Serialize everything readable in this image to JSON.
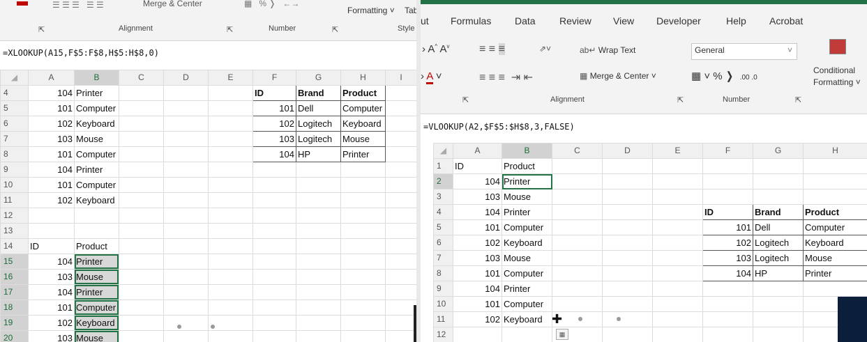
{
  "left": {
    "ribbon": {
      "groups": [
        "Alignment",
        "Number"
      ],
      "partial_labels": [
        "Formatting",
        "Tab",
        "Style"
      ],
      "merge_partial": "Merge & Center"
    },
    "formula": "=XLOOKUP(A15,F$5:F$8,H$5:H$8,0)",
    "columns": [
      "A",
      "B",
      "C",
      "D",
      "E",
      "F",
      "G",
      "H",
      "I"
    ],
    "rows": [
      {
        "n": "4",
        "A": "104",
        "B": "Printer",
        "F": "ID",
        "G": "Brand",
        "H": "Product"
      },
      {
        "n": "5",
        "A": "101",
        "B": "Computer",
        "F": "101",
        "G": "Dell",
        "H": "Computer"
      },
      {
        "n": "6",
        "A": "102",
        "B": "Keyboard",
        "F": "102",
        "G": "Logitech",
        "H": "Keyboard"
      },
      {
        "n": "7",
        "A": "103",
        "B": "Mouse",
        "F": "103",
        "G": "Logitech",
        "H": "Mouse"
      },
      {
        "n": "8",
        "A": "101",
        "B": "Computer",
        "F": "104",
        "G": "HP",
        "H": "Printer"
      },
      {
        "n": "9",
        "A": "104",
        "B": "Printer"
      },
      {
        "n": "10",
        "A": "101",
        "B": "Computer"
      },
      {
        "n": "11",
        "A": "102",
        "B": "Keyboard"
      },
      {
        "n": "12"
      },
      {
        "n": "13"
      },
      {
        "n": "14",
        "A": "ID",
        "B": "Product"
      },
      {
        "n": "15",
        "A": "104",
        "B": "Printer"
      },
      {
        "n": "16",
        "A": "103",
        "B": "Mouse"
      },
      {
        "n": "17",
        "A": "104",
        "B": "Printer"
      },
      {
        "n": "18",
        "A": "101",
        "B": "Computer"
      },
      {
        "n": "19",
        "A": "102",
        "B": "Keyboard"
      },
      {
        "n": "20",
        "A": "103",
        "B": "Mouse"
      }
    ]
  },
  "right": {
    "tabs": [
      "ut",
      "Formulas",
      "Data",
      "Review",
      "View",
      "Developer",
      "Help",
      "Acrobat"
    ],
    "ribbon": {
      "wrap_text": "Wrap Text",
      "merge_center": "Merge & Center",
      "number_format": "General",
      "conditional": "Conditional",
      "formatting": "Formatting",
      "groups": [
        "Alignment",
        "Number"
      ]
    },
    "formula": "=VLOOKUP(A2,$F$5:$H$8,3,FALSE)",
    "columns": [
      "A",
      "B",
      "C",
      "D",
      "E",
      "F",
      "G",
      "H"
    ],
    "rows": [
      {
        "n": "1",
        "A": "ID",
        "B": "Product"
      },
      {
        "n": "2",
        "A": "104",
        "B": "Printer"
      },
      {
        "n": "3",
        "A": "103",
        "B": "Mouse"
      },
      {
        "n": "4",
        "A": "104",
        "B": "Printer",
        "F": "ID",
        "G": "Brand",
        "H": "Product"
      },
      {
        "n": "5",
        "A": "101",
        "B": "Computer",
        "F": "101",
        "G": "Dell",
        "H": "Computer"
      },
      {
        "n": "6",
        "A": "102",
        "B": "Keyboard",
        "F": "102",
        "G": "Logitech",
        "H": "Keyboard"
      },
      {
        "n": "7",
        "A": "103",
        "B": "Mouse",
        "F": "103",
        "G": "Logitech",
        "H": "Mouse"
      },
      {
        "n": "8",
        "A": "101",
        "B": "Computer",
        "F": "104",
        "G": "HP",
        "H": "Printer"
      },
      {
        "n": "9",
        "A": "104",
        "B": "Printer"
      },
      {
        "n": "10",
        "A": "101",
        "B": "Computer"
      },
      {
        "n": "11",
        "A": "102",
        "B": "Keyboard"
      },
      {
        "n": "12"
      }
    ]
  },
  "colors": {
    "excel_green": "#217346",
    "font_red": "#c00000"
  }
}
